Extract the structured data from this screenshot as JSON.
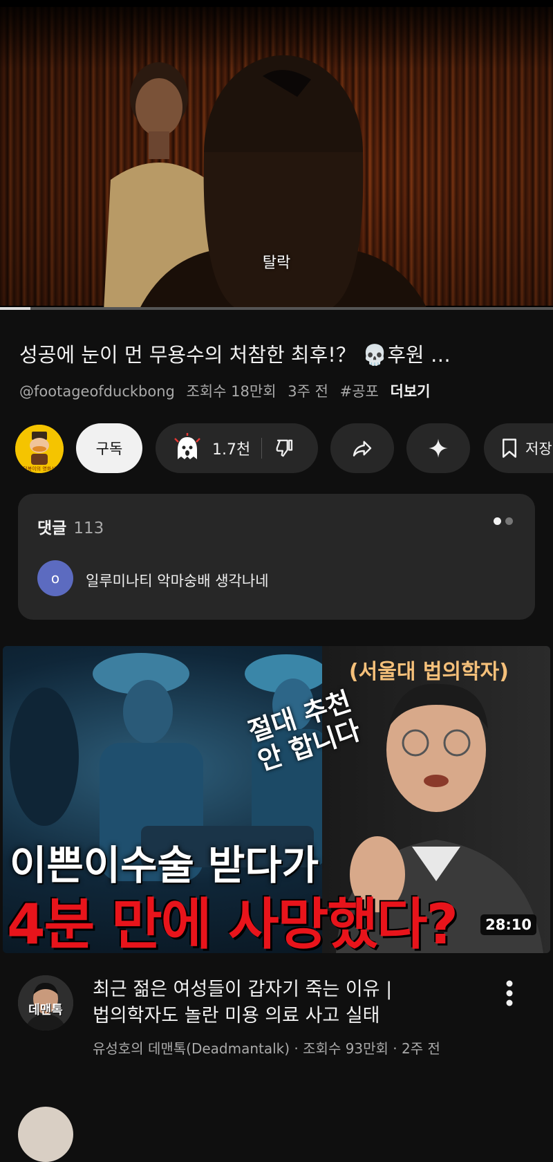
{
  "player": {
    "subtitle": "탈락",
    "progress": 0.055
  },
  "video": {
    "title": "성공에 눈이 먼 무용수의 처참한 최후!？ 💀후원 …",
    "channel_handle": "@footageofduckbong",
    "views": "조회수 18만회",
    "age": "3주 전",
    "hashtag": "#공포",
    "more_label": "더보기"
  },
  "actions": {
    "subscribe_label": "구독",
    "like_count": "1.7천",
    "save_label": "저장"
  },
  "comments": {
    "label": "댓글",
    "count": "113",
    "top_comment": {
      "avatar_letter": "o",
      "text": "일루미나티 악마숭배 생각나네"
    }
  },
  "recommended": {
    "thumbnail": {
      "top_text": "(서울대 법의학자)",
      "hand_line1": "절대 추천",
      "hand_line2": "안 합니다",
      "line1": "이쁜이수술 받다가",
      "line2": "4분 만에 사망했다?",
      "duration": "28:10"
    },
    "channel_avatar_text": "데맨톡",
    "title_line1": "최근 젊은 여성들이 갑자기 죽는 이유 |",
    "title_line2": "법의학자도 놀란 미용 의료 사고 실태",
    "meta": "유성호의 데맨톡(Deadmantalk) · 조회수 93만회 · 2주 전"
  },
  "colors": {
    "background": "#0f0f0f",
    "card": "#272727",
    "accent_red": "#e8141b",
    "avatar_purple": "#5c6bc0"
  }
}
